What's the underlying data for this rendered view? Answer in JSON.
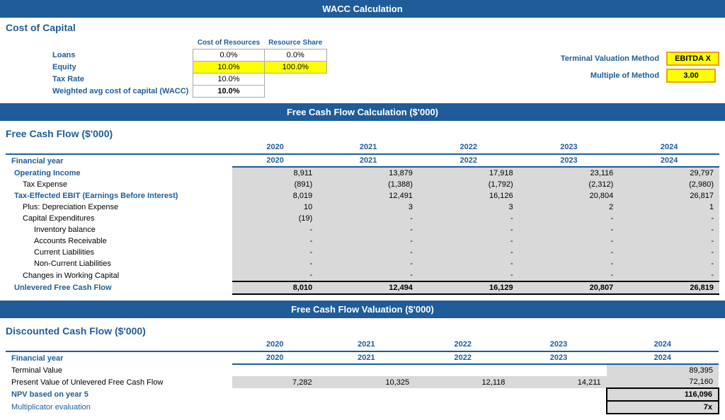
{
  "page": {
    "wacc_header": "WACC Calculation",
    "cost_of_capital_title": "Cost of Capital",
    "cost_of_resources_label": "Cost of Resources",
    "resource_share_label": "Resource Share",
    "loans_label": "Loans",
    "loans_cost": "0.0%",
    "loans_share": "0.0%",
    "equity_label": "Equity",
    "equity_cost": "10.0%",
    "equity_share": "100.0%",
    "tax_rate_label": "Tax Rate",
    "tax_rate_val": "10.0%",
    "wacc_label": "Weighted avg cost of capital (WACC)",
    "wacc_val": "10.0%",
    "terminal_method_label": "Terminal Valuation Method",
    "terminal_method_val": "EBITDA X",
    "multiple_label": "Multiple of Method",
    "multiple_val": "3.00",
    "fcf_header": "Free Cash Flow Calculation ($'000)",
    "fcf_title": "Free Cash Flow ($'000)",
    "dcf_header": "Free Cash Flow Valuation ($'000)",
    "dcf_title": "Discounted Cash Flow ($'000)",
    "years": [
      "2020",
      "2021",
      "2022",
      "2023",
      "2024"
    ],
    "fcf_rows": [
      {
        "label": "Financial year",
        "type": "header",
        "values": [
          "2020",
          "2021",
          "2022",
          "2023",
          "2024"
        ]
      },
      {
        "label": "Operating Income",
        "type": "operating",
        "indent": 0,
        "values": [
          "8,911",
          "13,879",
          "17,918",
          "23,116",
          "29,797"
        ]
      },
      {
        "label": "Tax Expense",
        "type": "normal",
        "indent": 1,
        "values": [
          "(891)",
          "(1,388)",
          "(1,792)",
          "(2,312)",
          "(2,980)"
        ]
      },
      {
        "label": "Tax-Effected EBIT (Earnings Before Interest)",
        "type": "bold",
        "indent": 0,
        "values": [
          "8,019",
          "12,491",
          "16,126",
          "20,804",
          "26,817"
        ]
      },
      {
        "label": "Plus: Depreciation Expense",
        "type": "normal",
        "indent": 1,
        "values": [
          "10",
          "3",
          "3",
          "2",
          "1"
        ]
      },
      {
        "label": "Capital Expenditures",
        "type": "normal",
        "indent": 1,
        "values": [
          "(19)",
          "-",
          "-",
          "-",
          "-"
        ]
      },
      {
        "label": "Inventory balance",
        "type": "normal",
        "indent": 2,
        "values": [
          "-",
          "-",
          "-",
          "-",
          "-"
        ]
      },
      {
        "label": "Accounts Receivable",
        "type": "normal",
        "indent": 2,
        "values": [
          "-",
          "-",
          "-",
          "-",
          "-"
        ]
      },
      {
        "label": "Current Liabilities",
        "type": "normal",
        "indent": 2,
        "values": [
          "-",
          "-",
          "-",
          "-",
          "-"
        ]
      },
      {
        "label": "Non-Current Liabilities",
        "type": "normal",
        "indent": 2,
        "values": [
          "-",
          "-",
          "-",
          "-",
          "-"
        ]
      },
      {
        "label": "Changes in Working Capital",
        "type": "normal",
        "indent": 1,
        "values": [
          "-",
          "-",
          "-",
          "-",
          "-"
        ]
      },
      {
        "label": "Unlevered Free Cash Flow",
        "type": "total",
        "indent": 0,
        "values": [
          "8,010",
          "12,494",
          "16,129",
          "20,807",
          "26,819"
        ]
      }
    ],
    "dcf_rows": [
      {
        "label": "Financial year",
        "type": "header",
        "values": [
          "2020",
          "2021",
          "2022",
          "2023",
          "2024"
        ]
      },
      {
        "label": "Terminal Value",
        "type": "normal_right",
        "values": [
          "",
          "",
          "",
          "",
          "89,395"
        ]
      },
      {
        "label": "Present Value of Unlevered Free Cash Flow",
        "type": "normal",
        "values": [
          "7,282",
          "10,325",
          "12,118",
          "14,211",
          "72,160"
        ]
      },
      {
        "label": "NPV based on year 5",
        "type": "npv",
        "values": [
          "",
          "",
          "",
          "",
          "116,096"
        ]
      },
      {
        "label": "Multiplicator evaluation",
        "type": "mult",
        "values": [
          "",
          "",
          "",
          "",
          "7x"
        ]
      }
    ]
  }
}
